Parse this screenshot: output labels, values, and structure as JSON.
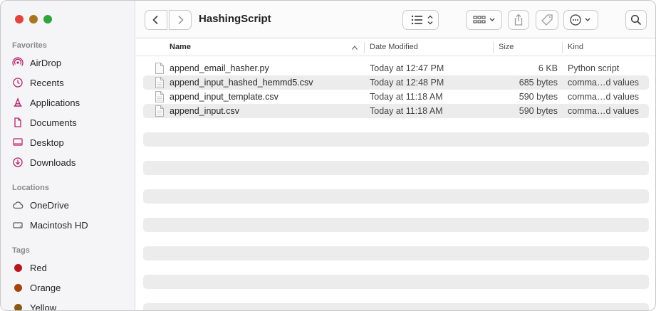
{
  "window": {
    "title": "HashingScript"
  },
  "sidebar": {
    "favorites_title": "Favorites",
    "favorites": [
      {
        "label": "AirDrop",
        "icon": "airdrop-icon"
      },
      {
        "label": "Recents",
        "icon": "clock-icon"
      },
      {
        "label": "Applications",
        "icon": "applications-icon"
      },
      {
        "label": "Documents",
        "icon": "document-icon"
      },
      {
        "label": "Desktop",
        "icon": "desktop-icon"
      },
      {
        "label": "Downloads",
        "icon": "download-icon"
      }
    ],
    "locations_title": "Locations",
    "locations": [
      {
        "label": "OneDrive",
        "icon": "cloud-icon"
      },
      {
        "label": "Macintosh HD",
        "icon": "drive-icon"
      }
    ],
    "tags_title": "Tags",
    "tags": [
      {
        "label": "Red",
        "color": "#b8151c"
      },
      {
        "label": "Orange",
        "color": "#a8420b"
      },
      {
        "label": "Yellow",
        "color": "#8a5a12"
      }
    ]
  },
  "columns": {
    "name": "Name",
    "date": "Date Modified",
    "size": "Size",
    "kind": "Kind"
  },
  "files": [
    {
      "name": "append_email_hasher.py",
      "date": "Today at 12:47 PM",
      "size": "6 KB",
      "kind": "Python script"
    },
    {
      "name": "append_input_hashed_hemmd5.csv",
      "date": "Today at 12:48 PM",
      "size": "685 bytes",
      "kind": "comma…d values"
    },
    {
      "name": "append_input_template.csv",
      "date": "Today at 11:18 AM",
      "size": "590 bytes",
      "kind": "comma…d values"
    },
    {
      "name": "append_input.csv",
      "date": "Today at 11:18 AM",
      "size": "590 bytes",
      "kind": "comma…d values"
    }
  ],
  "colors": {
    "accent": "#b3256b",
    "close": "#e0443e",
    "minimize": "#a7761f",
    "zoom": "#2fa53b"
  }
}
